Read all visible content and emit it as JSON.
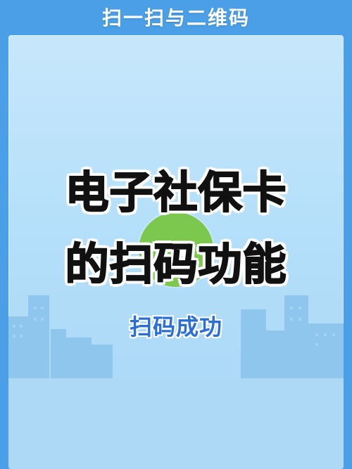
{
  "header": {
    "title": "扫一扫与二维码"
  },
  "main": {
    "headline_line1": "电子社保卡",
    "headline_line2": "的扫码功能",
    "status_text": "扫码成功"
  },
  "colors": {
    "frame_blue": "#4a9fe6",
    "panel_light_blue": "#b6e0fa",
    "success_green": "#7cc84f",
    "status_blue": "#2b6fd6",
    "skyline_blue": "#8fc6ee"
  },
  "icons": {
    "badge": "checkmark-icon",
    "background": "city-skyline-illustration"
  }
}
